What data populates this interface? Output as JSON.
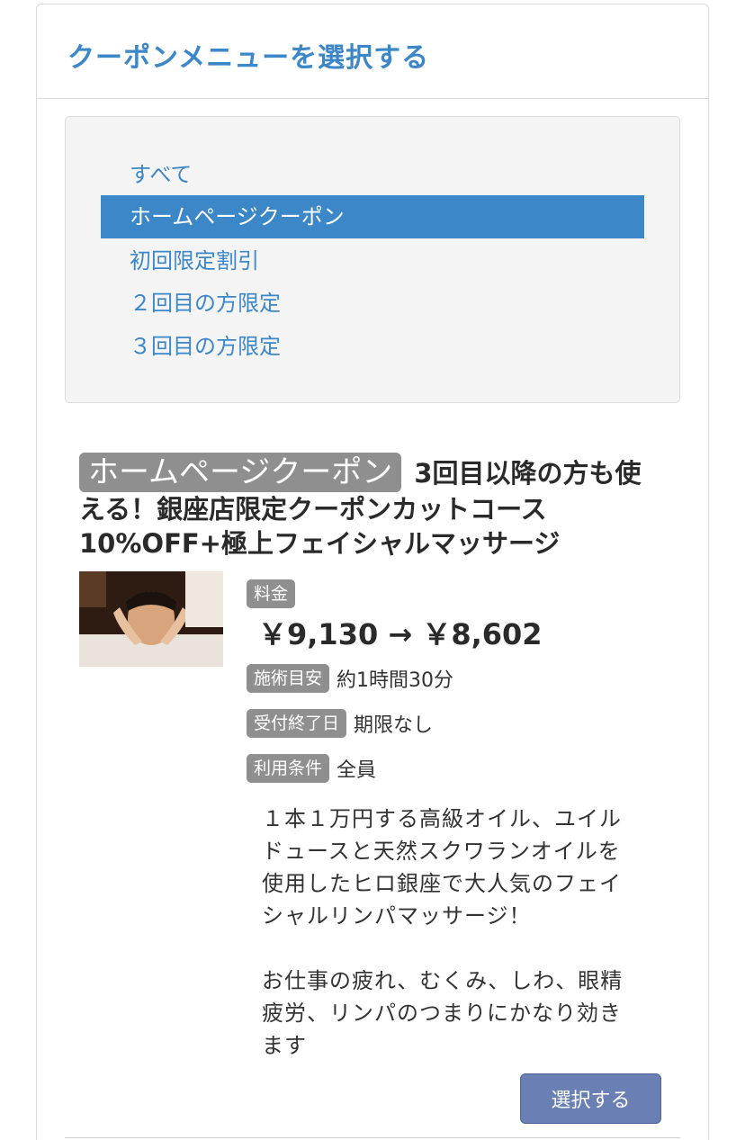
{
  "panel": {
    "title": "クーポンメニューを選択する"
  },
  "menu": {
    "items": [
      {
        "label": "すべて",
        "active": false
      },
      {
        "label": "ホームページクーポン",
        "active": true
      },
      {
        "label": "初回限定割引",
        "active": false
      },
      {
        "label": "２回目の方限定",
        "active": false
      },
      {
        "label": "３回目の方限定",
        "active": false
      }
    ]
  },
  "coupon": {
    "tag": "ホームページクーポン",
    "title": "3回目以降の方も使える！銀座店限定クーポンカットコース10%OFF+極上フェイシャルマッサージ",
    "price_label": "料金",
    "price": "￥9,130 → ￥8,602",
    "duration_label": "施術目安",
    "duration": "約1時間30分",
    "deadline_label": "受付終了日",
    "deadline": "期限なし",
    "condition_label": "利用条件",
    "condition": "全員",
    "description": "１本１万円する高級オイル、ユイルドュースと天然スクワランオイルを使用したヒロ銀座で大人気のフェイシャルリンパマッサージ！\n\nお仕事の疲れ、むくみ、しわ、眼精疲労、リンパのつまりにかなり効きます",
    "select_button": "選択する"
  },
  "colors": {
    "accent": "#3b87c8",
    "tag_gray": "#8f8f8f",
    "button": "#6a7fb3"
  }
}
